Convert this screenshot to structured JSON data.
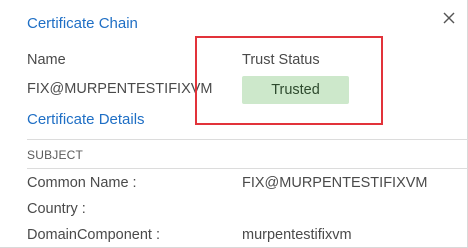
{
  "dialog": {
    "title": "Certificate Chain",
    "close_icon": "close-icon",
    "name_label": "Name",
    "name_value": "FIX@MURPENTESTIFIXVM",
    "trust_status_label": "Trust Status",
    "trust_status_value": "Trusted",
    "highlight_color": "#e2333a",
    "trusted_badge_color": "#cde8cb",
    "accent_color": "#1f6fc5"
  },
  "details": {
    "title": "Certificate Details",
    "subject_label": "SUBJECT",
    "rows": [
      {
        "label": "Common Name :",
        "value": "FIX@MURPENTESTIFIXVM"
      },
      {
        "label": "Country :",
        "value": ""
      },
      {
        "label": "DomainComponent :",
        "value": "murpentestifixvm"
      }
    ]
  }
}
